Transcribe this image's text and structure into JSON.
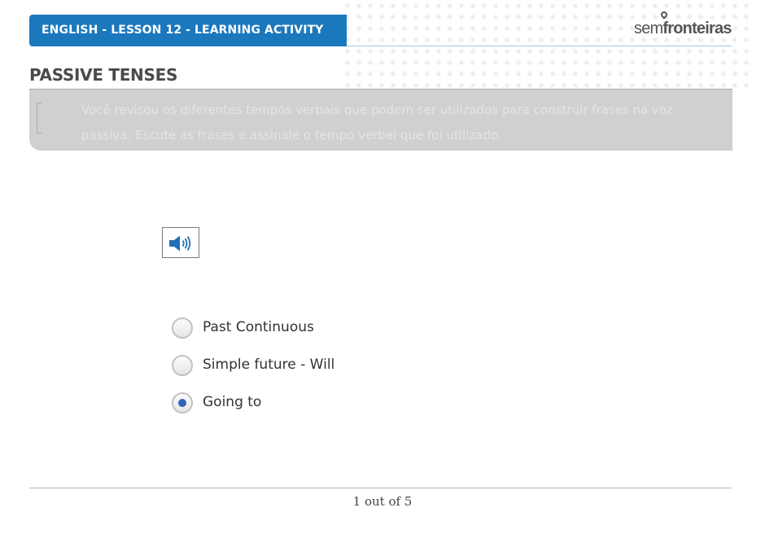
{
  "header": {
    "title": "ENGLISH - LESSON 12 - LEARNING ACTIVITY"
  },
  "logo": {
    "prefix": "sem",
    "suffix": "fronteiras"
  },
  "section": {
    "title": "PASSIVE TENSES"
  },
  "instructions": {
    "text": "Você revisou os diferentes tempos verbais que podem ser utilizados para construir frases na voz passiva. Escute as frases e assinale o tempo verbal que foi utilizado."
  },
  "audio": {
    "icon": "speaker-icon"
  },
  "options": [
    {
      "label": "Past Continuous",
      "selected": false
    },
    {
      "label": "Simple future - Will",
      "selected": false
    },
    {
      "label": "Going to",
      "selected": true
    }
  ],
  "pagination": {
    "text": "1 out of 5"
  },
  "colors": {
    "header_blue": "#1b78bd",
    "radio_selected": "#2e63b8",
    "instructions_bg": "#d0d0d0"
  }
}
